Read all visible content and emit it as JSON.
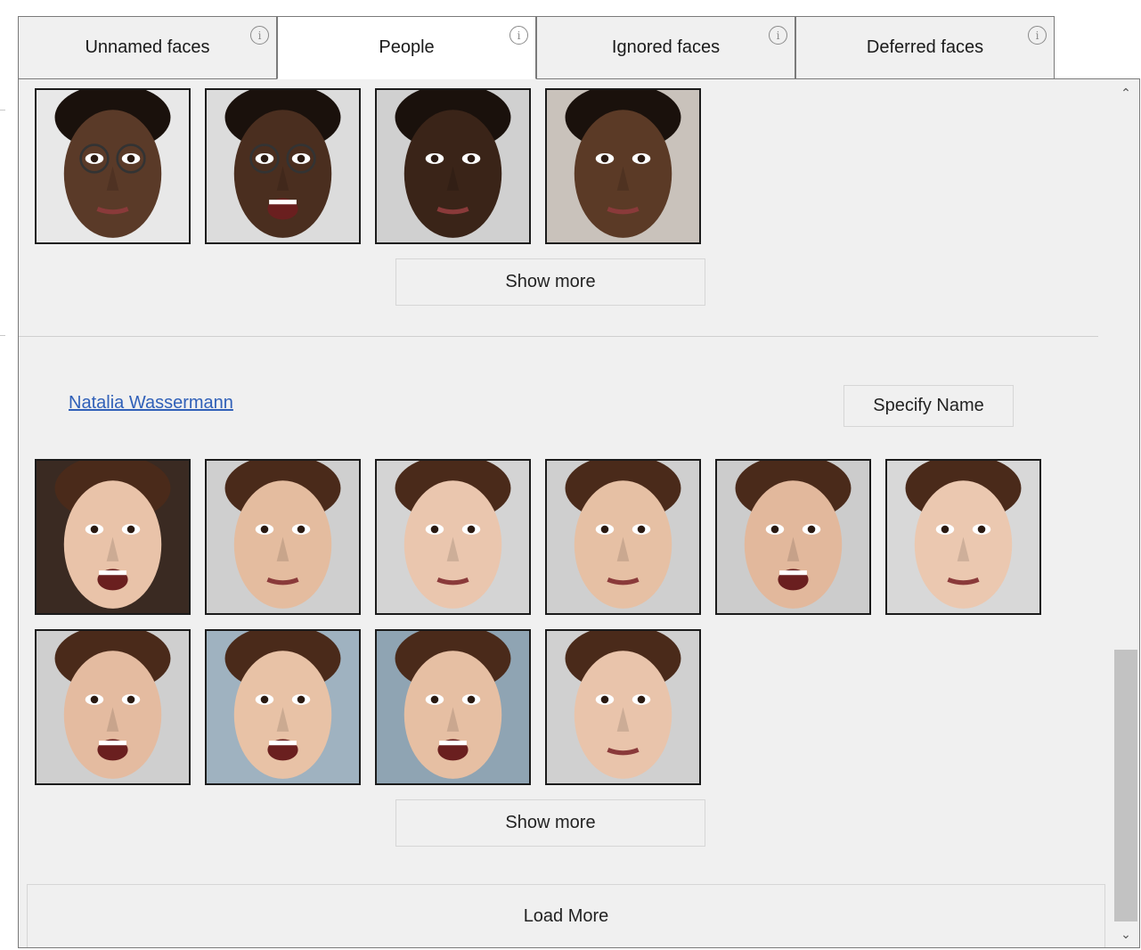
{
  "tabs": [
    {
      "label": "Unnamed faces",
      "info": "i",
      "active": false
    },
    {
      "label": "People",
      "info": "i",
      "active": true
    },
    {
      "label": "Ignored faces",
      "info": "i",
      "active": false
    },
    {
      "label": "Deferred faces",
      "info": "i",
      "active": false
    }
  ],
  "group_top": {
    "thumb_count": 4,
    "show_more_label": "Show more"
  },
  "group_natalia": {
    "person_name": "Natalia Wassermann",
    "specify_name_label": "Specify Name",
    "thumb_count": 10,
    "show_more_label": "Show more"
  },
  "load_more_label": "Load More",
  "scrollbar": {
    "up_icon": "chevron-up-icon",
    "down_icon": "chevron-down-icon",
    "up_glyph": "⌃",
    "down_glyph": "⌄"
  },
  "colors": {
    "panel_bg": "#f0f0f0",
    "link": "#3060b8",
    "thumb_border": "#1b1b1b"
  }
}
